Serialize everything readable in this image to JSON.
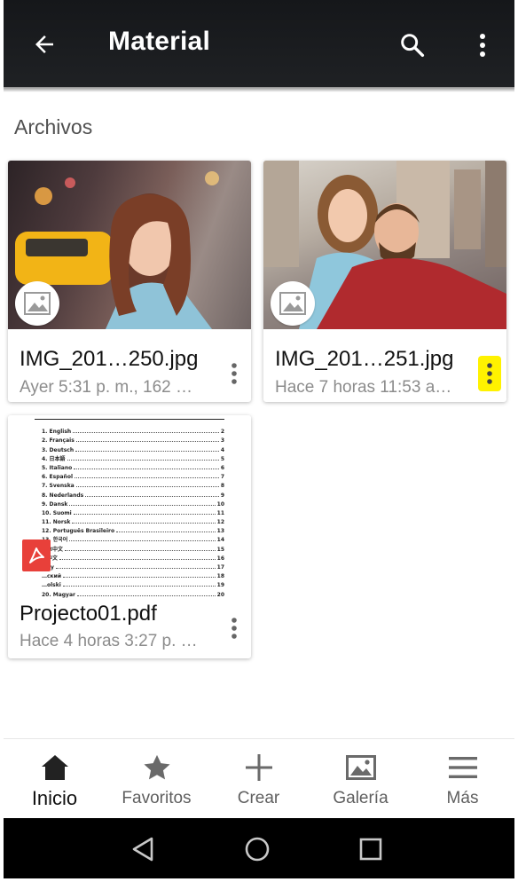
{
  "app_bar": {
    "title": "Material",
    "back_icon": "arrow-back-icon",
    "search_icon": "search-icon",
    "overflow_icon": "more-vert-icon"
  },
  "section": {
    "title": "Archivos"
  },
  "files": [
    {
      "name": "IMG_201…250.jpg",
      "meta": "Ayer 5:31 p. m., 162 …",
      "type_icon": "image-icon",
      "more_icon": "more-vert-icon",
      "highlighted": false
    },
    {
      "name": "IMG_201…251.jpg",
      "meta": "Hace 7 horas 11:53 a…",
      "type_icon": "image-icon",
      "more_icon": "more-vert-icon",
      "highlighted": true,
      "highlight_color": "#fff200"
    },
    {
      "name": "Projecto01.pdf",
      "meta": "Hace 4 horas 3:27 p. …",
      "type_icon": "pdf-icon",
      "more_icon": "more-vert-icon",
      "highlighted": false,
      "preview_toc": [
        {
          "label": "1. English",
          "page": "2"
        },
        {
          "label": "2. Français",
          "page": "3"
        },
        {
          "label": "3. Deutsch",
          "page": "4"
        },
        {
          "label": "4. 日本語",
          "page": "5"
        },
        {
          "label": "5. Italiano",
          "page": "6"
        },
        {
          "label": "6. Español",
          "page": "7"
        },
        {
          "label": "7. Svenska",
          "page": "8"
        },
        {
          "label": "8. Nederlands",
          "page": "9"
        },
        {
          "label": "9. Dansk",
          "page": "10"
        },
        {
          "label": "10. Suomi",
          "page": "11"
        },
        {
          "label": "11. Norsk",
          "page": "12"
        },
        {
          "label": "12. Português Brasileiro",
          "page": "13"
        },
        {
          "label": "13. 한국어",
          "page": "14"
        },
        {
          "label": "简体中文",
          "page": "15"
        },
        {
          "label": "繁中文",
          "page": "16"
        },
        {
          "label": "…ky",
          "page": "17"
        },
        {
          "label": "…ский",
          "page": "18"
        },
        {
          "label": "…olski",
          "page": "19"
        },
        {
          "label": "20. Magyar",
          "page": "20"
        }
      ]
    }
  ],
  "bottom_nav": [
    {
      "label": "Inicio",
      "icon": "home-icon",
      "active": true
    },
    {
      "label": "Favoritos",
      "icon": "star-icon",
      "active": false
    },
    {
      "label": "Crear",
      "icon": "plus-icon",
      "active": false
    },
    {
      "label": "Galería",
      "icon": "gallery-icon",
      "active": false
    },
    {
      "label": "Más",
      "icon": "menu-icon",
      "active": false
    }
  ],
  "system_nav": {
    "back_icon": "triangle-back-icon",
    "home_icon": "circle-home-icon",
    "recents_icon": "square-recents-icon"
  },
  "colors": {
    "app_bar": "#1a1c1f",
    "pdf_red": "#e8403a",
    "highlight": "#fff200"
  }
}
